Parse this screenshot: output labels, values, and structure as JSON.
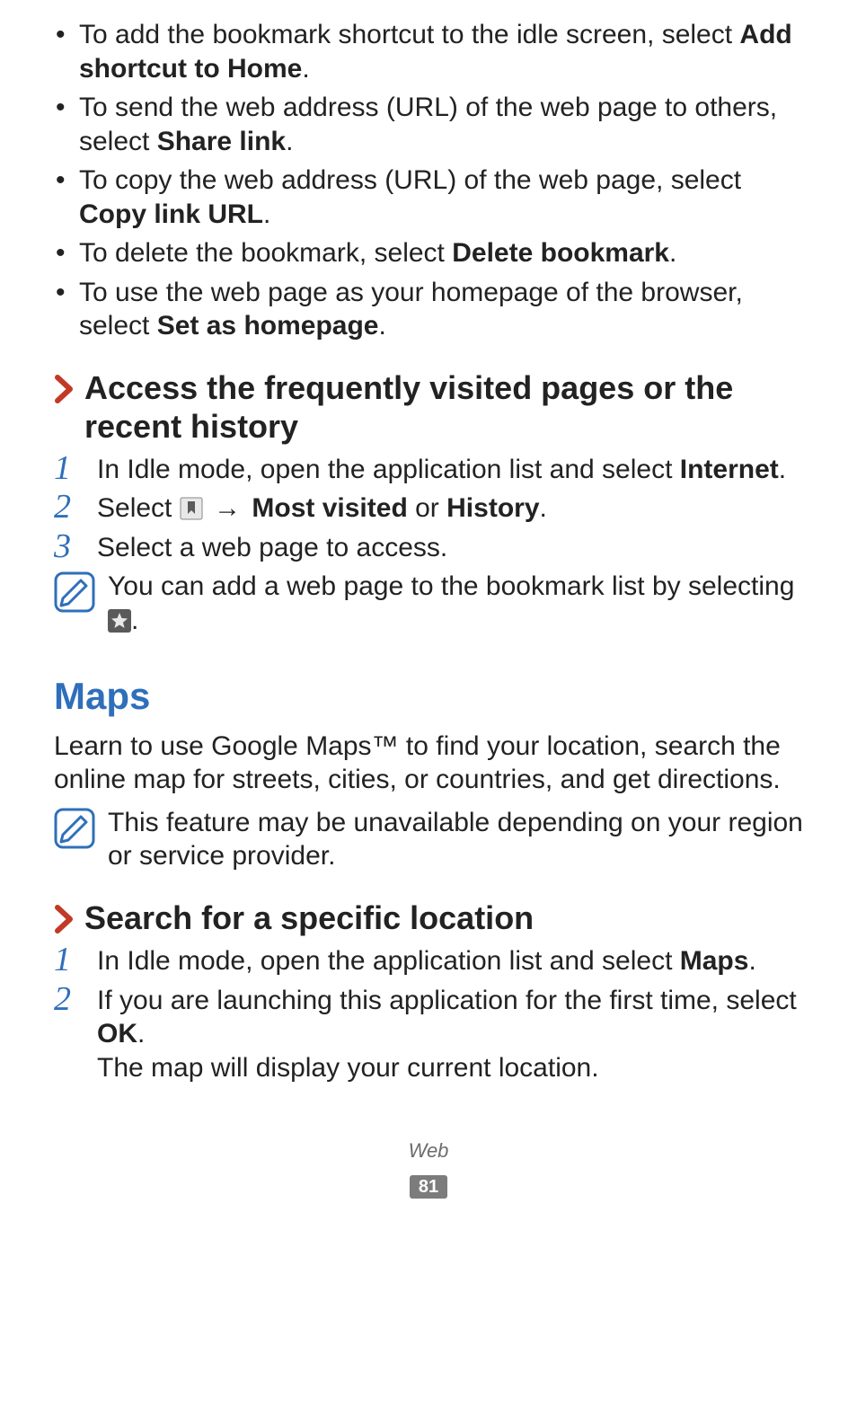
{
  "bullets": [
    {
      "pre": "To add the bookmark shortcut to the idle screen, select ",
      "bold": "Add shortcut to Home",
      "post": "."
    },
    {
      "pre": "To send the web address (URL) of the web page to others, select ",
      "bold": "Share link",
      "post": "."
    },
    {
      "pre": "To copy the web address (URL) of the web page, select ",
      "bold": "Copy link URL",
      "post": "."
    },
    {
      "pre": "To delete the bookmark, select ",
      "bold": "Delete bookmark",
      "post": "."
    },
    {
      "pre": "To use the web page as your homepage of the browser, select ",
      "bold": "Set as homepage",
      "post": "."
    }
  ],
  "section1_title": "Access the frequently visited pages or the recent history",
  "steps1": {
    "s1_pre": "In Idle mode, open the application list and select ",
    "s1_bold": "Internet",
    "s1_post": ".",
    "s2_pre": "Select ",
    "s2_arrow": "→",
    "s2_bold1": "Most visited",
    "s2_mid": " or ",
    "s2_bold2": "History",
    "s2_post": ".",
    "s3": "Select a web page to access."
  },
  "note1_pre": "You can add a web page to the bookmark list by selecting ",
  "note1_post": ".",
  "app_title": "Maps",
  "maps_intro": "Learn to use Google Maps™ to find your location, search the online map for streets, cities, or countries, and get directions.",
  "note2": "This feature may be unavailable depending on your region or service provider.",
  "section2_title": "Search for a specific location",
  "steps2": {
    "s1_pre": "In Idle mode, open the application list and select ",
    "s1_bold": "Maps",
    "s1_post": ".",
    "s2_pre": "If you are launching this application for the first time, select ",
    "s2_bold": "OK",
    "s2_post": ".",
    "s2_extra": "The map will display your current location."
  },
  "footer_label": "Web",
  "footer_page": "81"
}
